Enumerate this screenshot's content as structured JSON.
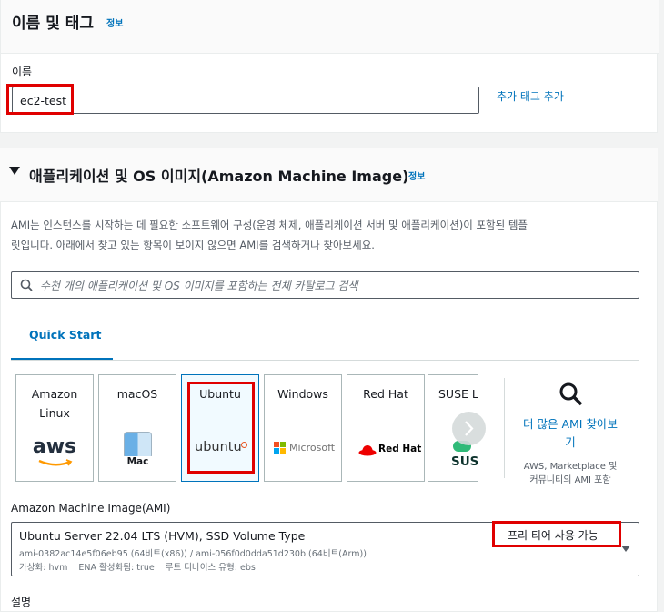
{
  "name_section": {
    "title": "이름 및 태그",
    "info": "정보",
    "name_label": "이름",
    "name_value": "ec2-test",
    "add_tag_link": "추가 태그 추가"
  },
  "ami_section": {
    "title": "애플리케이션 및 OS 이미지(Amazon Machine Image)",
    "info": "정보",
    "description_line1": "AMI는 인스턴스를 시작하는 데 필요한 소프트웨어 구성(운영 체제, 애플리케이션 서버 및 애플리케이션)이 포함된 템플",
    "description_line2": "릿입니다. 아래에서 찾고 있는 항목이 보이지 않으면 AMI를 검색하거나 찾아보세요.",
    "search_placeholder": "수천 개의 애플리케이션 및 OS 이미지를 포함하는 전체 카탈로그 검색",
    "tab_quick_start": "Quick Start",
    "tiles": [
      {
        "name": "Amazon Linux",
        "logo": "aws"
      },
      {
        "name": "macOS",
        "logo": "Mac"
      },
      {
        "name": "Ubuntu",
        "logo": "ubuntu"
      },
      {
        "name": "Windows",
        "logo": "Microsoft"
      },
      {
        "name": "Red Hat",
        "logo": "Red Hat"
      },
      {
        "name": "SUSE Li",
        "logo": "SUS"
      }
    ],
    "browse_more_line1": "더 많은 AMI 찾아보",
    "browse_more_line2": "기",
    "browse_more_sub1": "AWS, Marketplace 및",
    "browse_more_sub2": "커뮤니티의 AMI 포함",
    "ami_label": "Amazon Machine Image(AMI)",
    "selected_ami": {
      "name": "Ubuntu Server 22.04 LTS (HVM), SSD Volume Type",
      "ids": "ami-0382ac14e5f06eb95 (64비트(x86)) / ami-056f0d0dda51d230b (64비트(Arm))",
      "meta": "가상화: hvm    ENA 활성화됨: true    루트 디바이스 유형: ebs",
      "badge": "프리 티어 사용 가능"
    },
    "description_label": "설명"
  },
  "colors": {
    "accent": "#0073bb",
    "highlight": "#e00000",
    "tab_accent": "#0073bb"
  }
}
